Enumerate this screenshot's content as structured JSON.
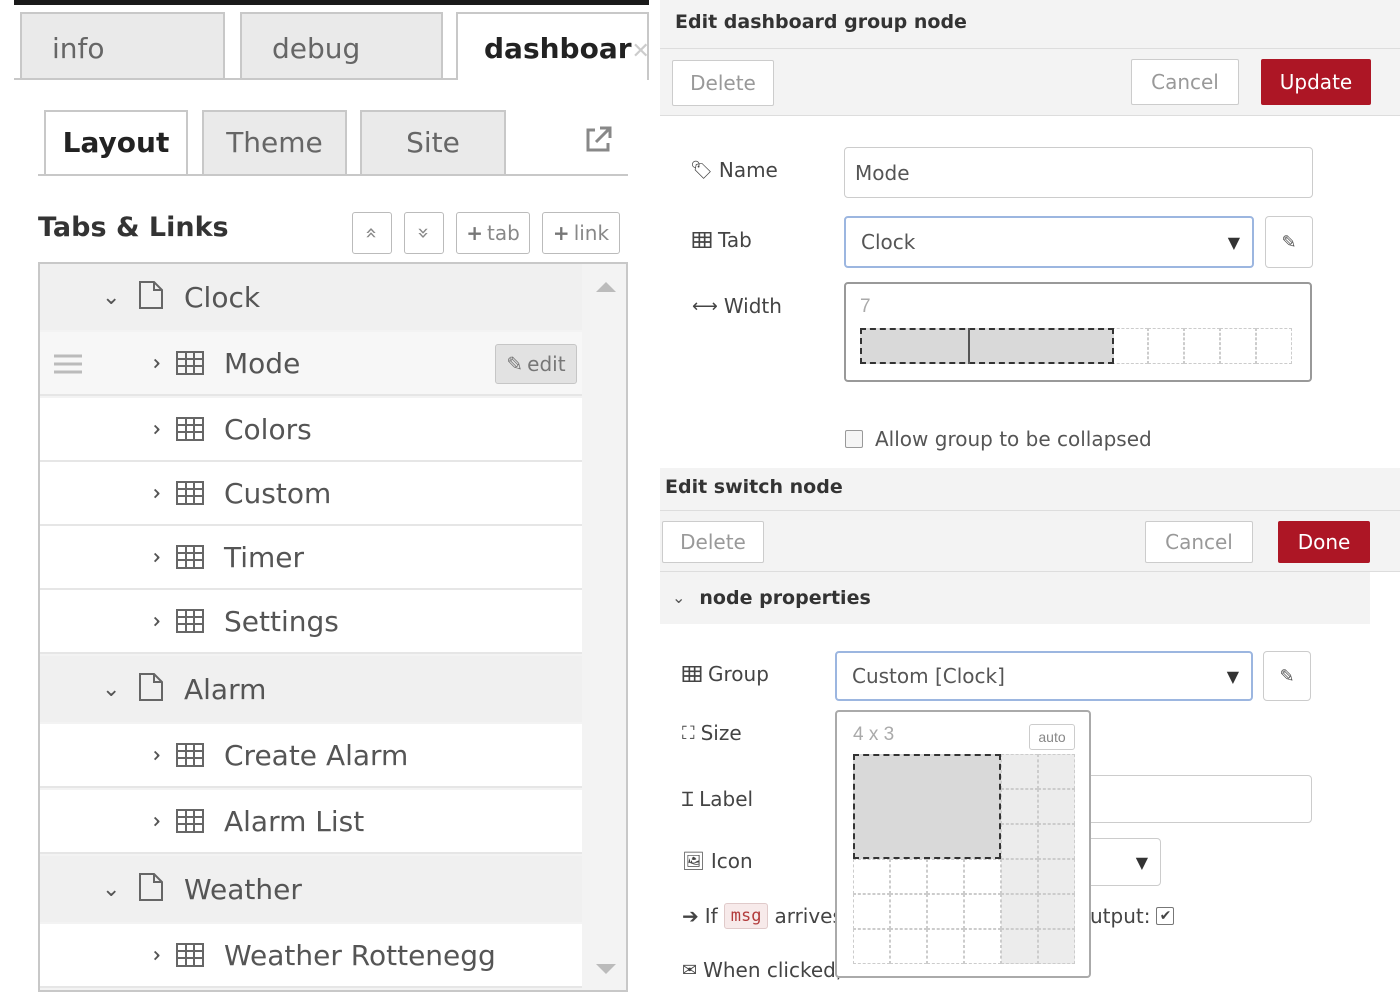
{
  "left": {
    "top_tabs": [
      {
        "label": "info"
      },
      {
        "label": "debug"
      },
      {
        "label": "dashboar",
        "close": "✕"
      }
    ],
    "sub_tabs": [
      {
        "label": "Layout"
      },
      {
        "label": "Theme"
      },
      {
        "label": "Site"
      }
    ],
    "section_title": "Tabs & Links",
    "toolbar": {
      "collapse_all": "«",
      "expand_all": "»",
      "add_tab": "tab",
      "add_link": "link"
    },
    "tree": {
      "edit_label": "edit",
      "tabs": [
        {
          "label": "Clock",
          "groups": [
            {
              "label": "Mode"
            },
            {
              "label": "Colors"
            },
            {
              "label": "Custom"
            },
            {
              "label": "Timer"
            },
            {
              "label": "Settings"
            }
          ]
        },
        {
          "label": "Alarm",
          "groups": [
            {
              "label": "Create Alarm"
            },
            {
              "label": "Alarm List"
            }
          ]
        },
        {
          "label": "Weather",
          "groups": [
            {
              "label": "Weather Rottenegg"
            }
          ]
        }
      ]
    }
  },
  "group_dialog": {
    "title": "Edit dashboard group node",
    "delete": "Delete",
    "cancel": "Cancel",
    "update": "Update",
    "name_label": "Name",
    "name_value": "Mode",
    "tab_label": "Tab",
    "tab_value": "Clock",
    "width_label": "Width",
    "width_value": "7",
    "collapse_label": "Allow group to be collapsed"
  },
  "switch_dialog": {
    "title": "Edit switch node",
    "delete": "Delete",
    "cancel": "Cancel",
    "done": "Done",
    "section": "node properties",
    "group_label": "Group",
    "group_value": "Custom [Clock]",
    "size_label": "Size",
    "size_value": "4 x 3",
    "auto_label": "auto",
    "label_label": "Label",
    "icon_label": "Icon",
    "if_label": "If",
    "msg_badge": "msg",
    "arrives_text": "arrives",
    "output_text": "utput:",
    "clicked_label": "When clicked,"
  },
  "colors": {
    "primary_button": "#ad1625",
    "focus_border": "#9cb6e0"
  }
}
